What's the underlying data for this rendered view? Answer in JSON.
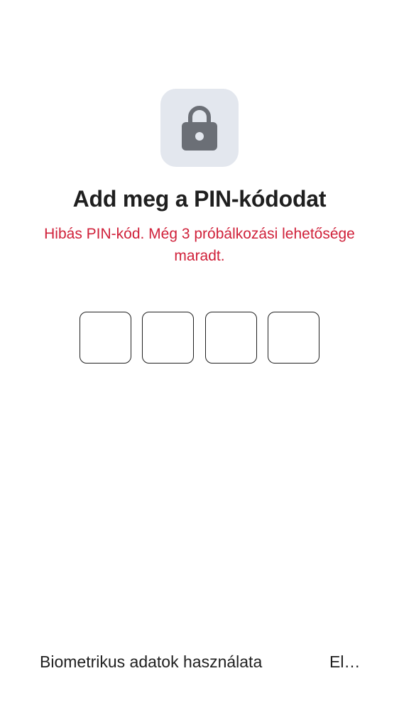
{
  "header": {
    "icon": "lock-icon",
    "title": "Add meg a PIN-kódodat",
    "error_message": "Hibás PIN-kód. Még 3 próbálkozási lehetősége maradt."
  },
  "pin": {
    "length": 4,
    "digits": [
      "",
      "",
      "",
      ""
    ]
  },
  "footer": {
    "biometrics_label": "Biometrikus adatok használata",
    "other_label": "El…"
  },
  "colors": {
    "error": "#d0213a",
    "icon_tile": "#e3e7ee",
    "icon": "#6b6f76",
    "text": "#1f1f1f"
  }
}
